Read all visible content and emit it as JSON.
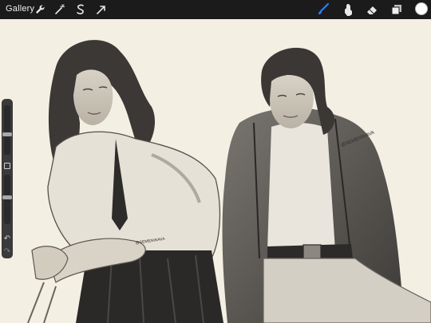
{
  "toolbar": {
    "gallery_label": "Gallery",
    "left_tools": [
      "wrench-icon",
      "magic-wand-icon",
      "selection-icon",
      "transform-arrow-icon"
    ],
    "right_tools": [
      "brush-icon",
      "smudge-icon",
      "eraser-icon",
      "layers-icon"
    ],
    "active_tool": "brush",
    "active_color": "#ffffff",
    "accent_color": "#2f7df6"
  },
  "sidebar": {
    "brush_size_level": 0.4,
    "opacity_level": 0.55,
    "undo_icon": "undo-icon",
    "redo_icon": "redo-icon"
  },
  "canvas": {
    "signature_left": "@SEMENINAVA",
    "signature_right": "@SEMENINAVA"
  }
}
